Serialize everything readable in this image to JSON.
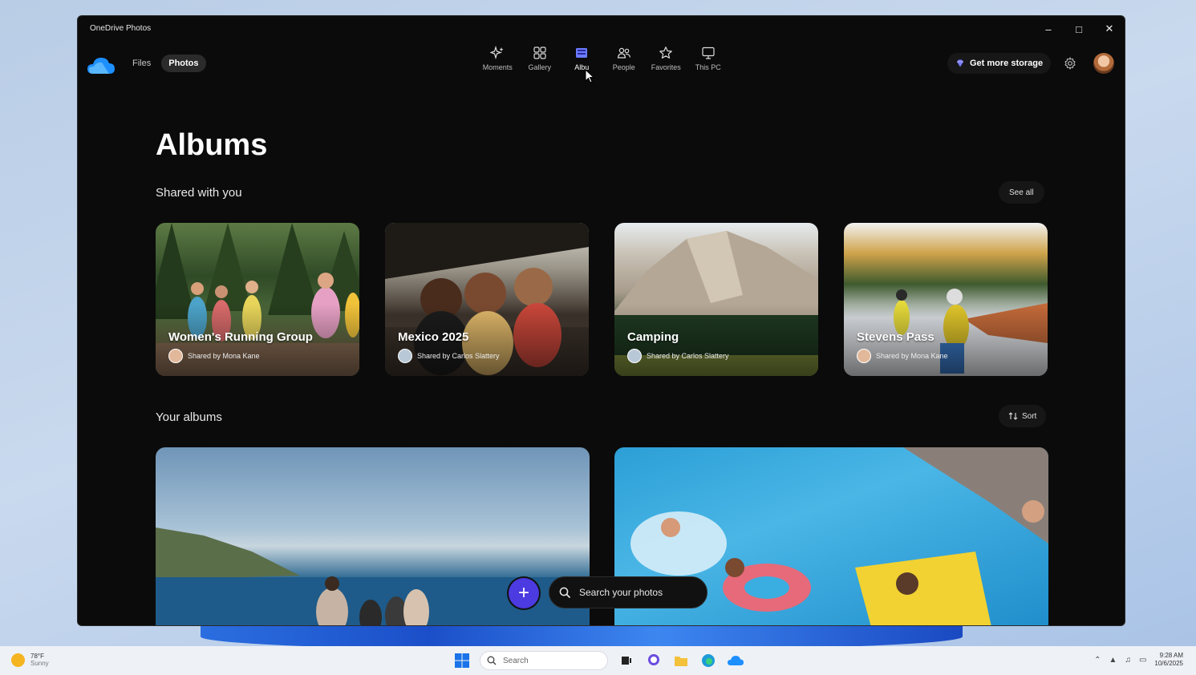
{
  "window": {
    "title": "OneDrive Photos"
  },
  "appbar": {
    "tabs": [
      "Files",
      "Photos"
    ],
    "active_tab": "Photos",
    "nav": [
      {
        "label": "Moments"
      },
      {
        "label": "Gallery"
      },
      {
        "label": "Albu"
      },
      {
        "label": "People"
      },
      {
        "label": "Favorites"
      },
      {
        "label": "This PC"
      }
    ],
    "active_nav": "Albums",
    "storage_button": "Get more storage"
  },
  "page": {
    "title": "Albums",
    "shared_section": {
      "title": "Shared with you",
      "see_all": "See all"
    },
    "shared_albums": [
      {
        "name": "Women's Running Group",
        "shared_by": "Shared by Mona Kane"
      },
      {
        "name": "Mexico 2025",
        "shared_by": "Shared by Carlos Slattery"
      },
      {
        "name": "Camping",
        "shared_by": "Shared by Carlos Slattery"
      },
      {
        "name": "Stevens Pass",
        "shared_by": "Shared by Mona Kane"
      }
    ],
    "your_section": {
      "title": "Your albums",
      "sort": "Sort"
    }
  },
  "bottom": {
    "add_symbol": "+",
    "search_placeholder": "Search your photos"
  },
  "taskbar": {
    "weather_temp": "78°F",
    "weather_cond": "Sunny",
    "search_label": "Search",
    "time": "9:28 AM",
    "date": "10/6/2025"
  },
  "colors": {
    "accent": "#4b3be0",
    "window_bg": "#0b0b0b",
    "active_nav": "#6b7bff"
  }
}
